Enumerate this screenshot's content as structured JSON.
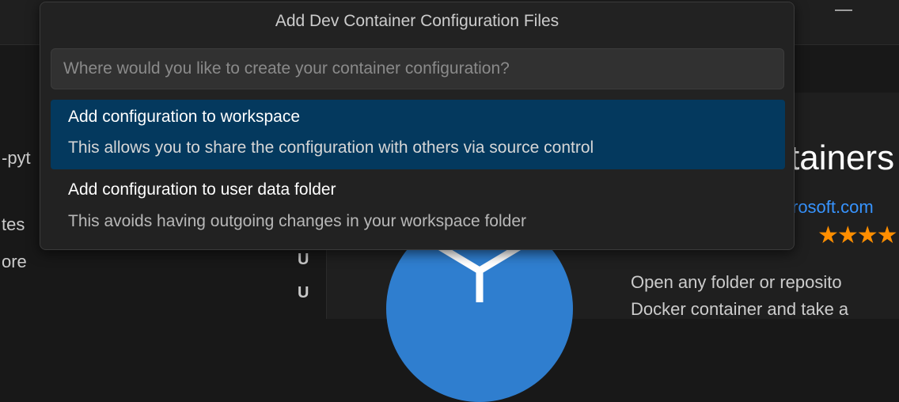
{
  "background": {
    "sidebar_fragments": [
      "-pyt",
      "tes",
      "ore"
    ],
    "git_status": [
      "U",
      "U"
    ],
    "extension": {
      "title_fragment": "tainers",
      "publisher_fragment": "rosoft.com",
      "stars": "★★★★",
      "description_lines": [
        "Open any folder or reposito",
        "Docker container and take a"
      ]
    }
  },
  "quick_pick": {
    "title": "Add Dev Container Configuration Files",
    "placeholder": "Where would you like to create your container configuration?",
    "input_value": "",
    "items": [
      {
        "label": "Add configuration to workspace",
        "detail": "This allows you to share the configuration with others via source control",
        "selected": true
      },
      {
        "label": "Add configuration to user data folder",
        "detail": "This avoids having outgoing changes in your workspace folder",
        "selected": false
      }
    ]
  },
  "colors": {
    "selection": "#04395e",
    "link": "#3794ff",
    "stars": "#ff8e00",
    "icon_blue": "#2f7ecf"
  }
}
